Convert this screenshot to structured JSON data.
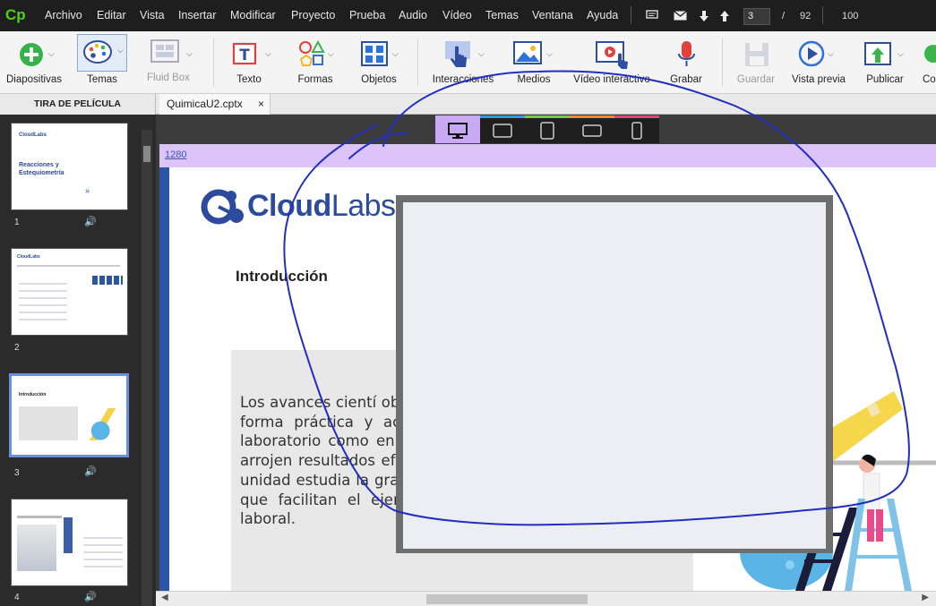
{
  "app": {
    "logo": "Cp"
  },
  "menu": [
    "Archivo",
    "Editar",
    "Vista",
    "Insertar",
    "Modificar",
    "Proyecto",
    "Prueba",
    "Audio",
    "Vídeo",
    "Temas",
    "Ventana",
    "Ayuda"
  ],
  "pager": {
    "current": "3",
    "separator": "/",
    "total": "92",
    "zoom": "100"
  },
  "toolbar": {
    "diapositivas": "Diapositivas",
    "temas": "Temas",
    "fluid_box": "Fluid Box",
    "texto": "Texto",
    "formas": "Formas",
    "objetos": "Objetos",
    "interacciones": "Interacciones",
    "medios": "Medios",
    "video_interactivo": "Vídeo interactivo",
    "grabar": "Grabar",
    "guardar": "Guardar",
    "vista_previa": "Vista previa",
    "publicar": "Publicar",
    "co": "Co"
  },
  "filmstrip": {
    "header": "TIRA DE PELÍCULA",
    "slides": [
      {
        "num": "1",
        "title": "Reacciones y Estequiometría",
        "logo": "CloudLabs"
      },
      {
        "num": "2",
        "logo": "CloudLabs"
      },
      {
        "num": "3",
        "title": "Introducción"
      },
      {
        "num": "4"
      }
    ]
  },
  "tab": {
    "name": "QuimicaU2.cptx",
    "close": "×"
  },
  "ruler": {
    "label": "1280"
  },
  "slide": {
    "logo_bold": "Cloud",
    "logo_light": "Labs",
    "heading": "Introducción",
    "paragraph": "Los avances cientí observación, como e procesos que perm forma práctica y acc que los procedimien tanto en el laboratorio como en el espacio laboral y de esta manera arrojen resultados efectivos. En lógicas a esto, la presente unidad estudia la gravimetría y la extracción de sustancias que facilitan el ejercicio académico dentro del entorno laboral."
  },
  "colors": {
    "accent_green": "#4fd11c",
    "slide_blue": "#2c55a6",
    "ruler_purple": "#dcc4fa",
    "annotation_blue": "#1f2fc0",
    "device_stripes": [
      "#c9a8f5",
      "#2f9be0",
      "#7ac943",
      "#f28c28",
      "#e2457a"
    ]
  }
}
